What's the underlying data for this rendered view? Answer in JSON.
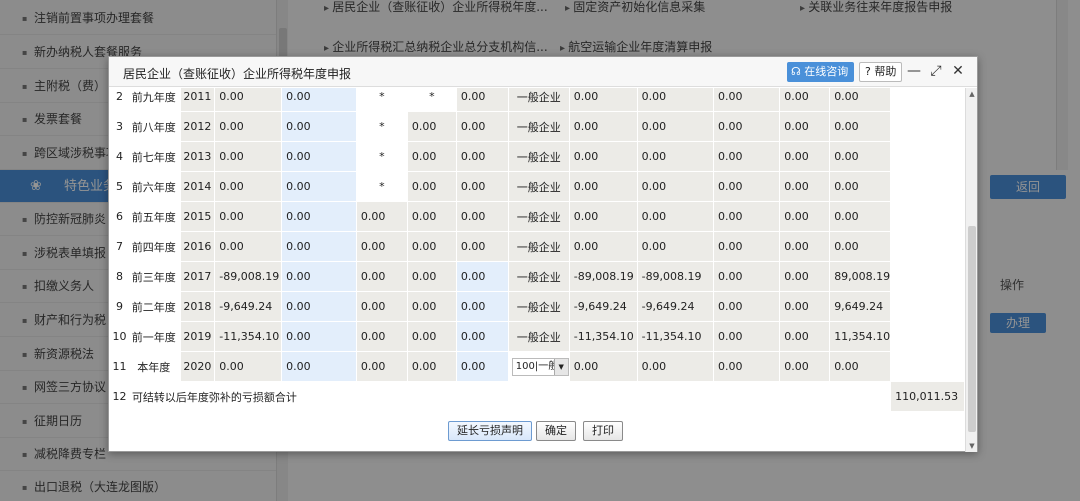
{
  "background": {
    "sidebar": {
      "items": [
        "注销前置事项办理套餐",
        "新办纳税人套餐服务",
        "主附税（费）",
        "发票套餐",
        "跨区域涉税事项",
        "特色业务",
        "防控新冠肺炎",
        "涉税表单填报",
        "扣缴义务人",
        "财产和行为税",
        "新资源税法",
        "网签三方协议",
        "征期日历",
        "减税降费专栏",
        "出口退税（大连龙图版）"
      ],
      "active_index": 5
    },
    "links": [
      "居民企业（查账征收）企业所得税年度...",
      "固定资产初始化信息采集",
      "关联业务往来年度报告申报",
      "企业所得税汇总纳税企业总分支机构信...",
      "航空运输企业年度清算申报"
    ],
    "return_button": "返回",
    "operation_header": "操作",
    "handle_button": "办理"
  },
  "dialog": {
    "title": "居民企业（查账征收）企业所得税年度申报",
    "consult_button": "在线咨询",
    "help_button": "帮助",
    "help_prefix": "?",
    "minimize": "—",
    "restore": "⤢",
    "close": "✕",
    "rows": [
      {
        "idx": "2",
        "label": "前九年度",
        "year": "2011",
        "c1": "0.00",
        "c2": "0.00",
        "c3": "*",
        "c4": "*",
        "c5": "0.00",
        "type": "一般企业",
        "c6": "0.00",
        "c7": "0.00",
        "c8": "0.00",
        "c9": "0.00",
        "c10": "0.00"
      },
      {
        "idx": "3",
        "label": "前八年度",
        "year": "2012",
        "c1": "0.00",
        "c2": "0.00",
        "c3": "*",
        "c4": "0.00",
        "c5": "0.00",
        "type": "一般企业",
        "c6": "0.00",
        "c7": "0.00",
        "c8": "0.00",
        "c9": "0.00",
        "c10": "0.00"
      },
      {
        "idx": "4",
        "label": "前七年度",
        "year": "2013",
        "c1": "0.00",
        "c2": "0.00",
        "c3": "*",
        "c4": "0.00",
        "c5": "0.00",
        "type": "一般企业",
        "c6": "0.00",
        "c7": "0.00",
        "c8": "0.00",
        "c9": "0.00",
        "c10": "0.00"
      },
      {
        "idx": "5",
        "label": "前六年度",
        "year": "2014",
        "c1": "0.00",
        "c2": "0.00",
        "c3": "*",
        "c4": "0.00",
        "c5": "0.00",
        "type": "一般企业",
        "c6": "0.00",
        "c7": "0.00",
        "c8": "0.00",
        "c9": "0.00",
        "c10": "0.00"
      },
      {
        "idx": "6",
        "label": "前五年度",
        "year": "2015",
        "c1": "0.00",
        "c2": "0.00",
        "c3": "0.00",
        "c4": "0.00",
        "c5": "0.00",
        "type": "一般企业",
        "c6": "0.00",
        "c7": "0.00",
        "c8": "0.00",
        "c9": "0.00",
        "c10": "0.00"
      },
      {
        "idx": "7",
        "label": "前四年度",
        "year": "2016",
        "c1": "0.00",
        "c2": "0.00",
        "c3": "0.00",
        "c4": "0.00",
        "c5": "0.00",
        "type": "一般企业",
        "c6": "0.00",
        "c7": "0.00",
        "c8": "0.00",
        "c9": "0.00",
        "c10": "0.00"
      },
      {
        "idx": "8",
        "label": "前三年度",
        "year": "2017",
        "c1": "-89,008.19",
        "c2": "0.00",
        "c3": "0.00",
        "c4": "0.00",
        "c5": "0.00",
        "type": "一般企业",
        "c6": "-89,008.19",
        "c7": "-89,008.19",
        "c8": "0.00",
        "c9": "0.00",
        "c10": "89,008.19"
      },
      {
        "idx": "9",
        "label": "前二年度",
        "year": "2018",
        "c1": "-9,649.24",
        "c2": "0.00",
        "c3": "0.00",
        "c4": "0.00",
        "c5": "0.00",
        "type": "一般企业",
        "c6": "-9,649.24",
        "c7": "-9,649.24",
        "c8": "0.00",
        "c9": "0.00",
        "c10": "9,649.24"
      },
      {
        "idx": "10",
        "label": "前一年度",
        "year": "2019",
        "c1": "-11,354.10",
        "c2": "0.00",
        "c3": "0.00",
        "c4": "0.00",
        "c5": "0.00",
        "type": "一般企业",
        "c6": "-11,354.10",
        "c7": "-11,354.10",
        "c8": "0.00",
        "c9": "0.00",
        "c10": "11,354.10"
      },
      {
        "idx": "11",
        "label": "本年度",
        "year": "2020",
        "c1": "0.00",
        "c2": "0.00",
        "c3": "0.00",
        "c4": "0.00",
        "c5": "0.00",
        "type": "100|一般",
        "c6": "0.00",
        "c7": "0.00",
        "c8": "0.00",
        "c9": "0.00",
        "c10": "0.00"
      }
    ],
    "total": {
      "idx": "12",
      "label": "可结转以后年度弥补的亏损额合计",
      "value": "110,011.53"
    },
    "buttons": {
      "extend": "延长亏损声明",
      "confirm": "确定",
      "print": "打印"
    }
  }
}
